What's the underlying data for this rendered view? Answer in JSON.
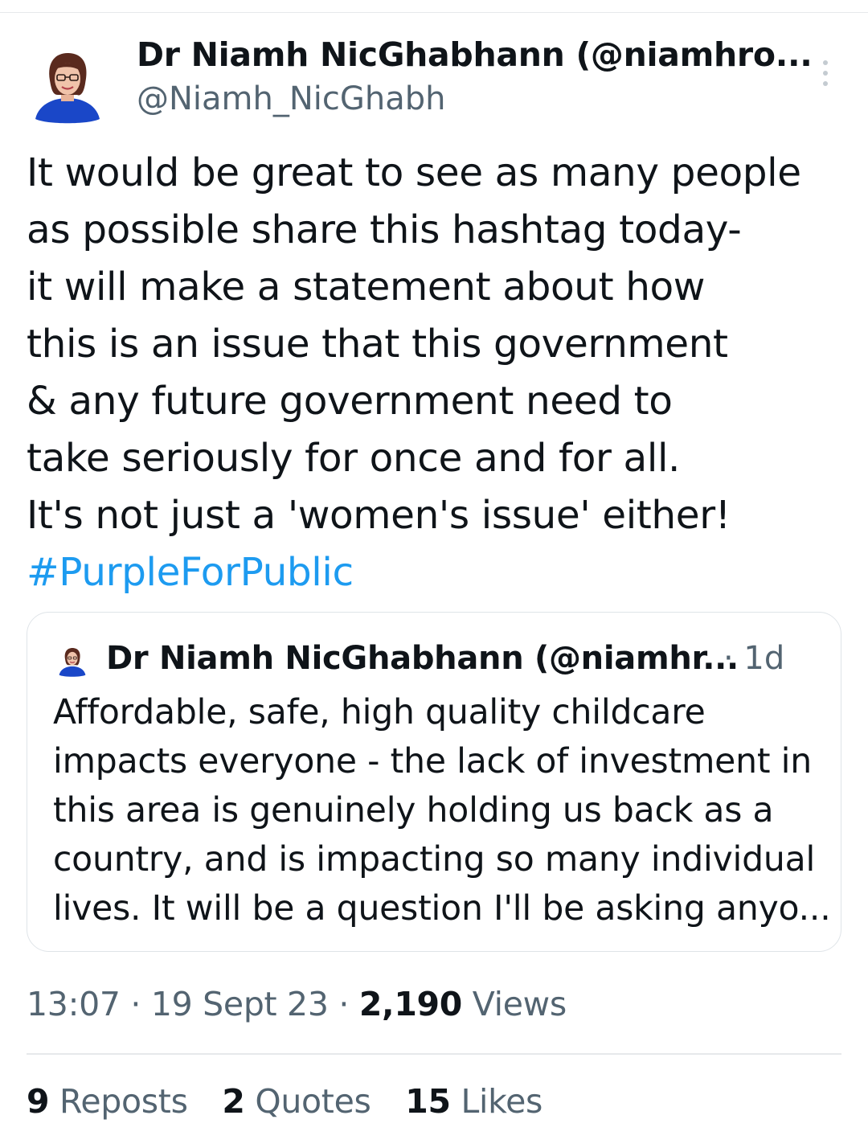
{
  "tweet": {
    "author_name": "Dr Niamh NicGhabhann (@niamhro...",
    "author_handle": "@Niamh_NicGhabh",
    "text_lines": [
      "It would be great to see as many people",
      "as possible share this hashtag today-",
      "it will make a statement about how",
      "this is an issue that this government",
      "& any future government need to",
      "take seriously for once and for all.",
      "It's not just a 'women's issue' either!"
    ],
    "hashtag": "#PurpleForPublic"
  },
  "quoted_tweet": {
    "author_name": "Dr Niamh NicGhabhann (@niamhr...",
    "time": "· 1d",
    "text_lines": [
      "Affordable, safe, high quality childcare",
      "impacts everyone - the lack of investment in",
      "this area is genuinely holding us back as a",
      "country, and is impacting so many individual",
      "lives. It will be a question I'll be asking anyo..."
    ]
  },
  "meta": {
    "time": "13:07",
    "separator": "·",
    "date": "19 Sept 23",
    "views_count": "2,190",
    "views_label": "Views"
  },
  "stats": {
    "reposts_count": "9",
    "reposts_label": "Reposts",
    "quotes_count": "2",
    "quotes_label": "Quotes",
    "likes_count": "15",
    "likes_label": "Likes"
  },
  "colors": {
    "hashtag": "#1d9bf0",
    "secondary_text": "#536471",
    "avatar_dress": "#1a47c8"
  },
  "icons": {
    "more": "vertical-ellipsis-icon"
  }
}
